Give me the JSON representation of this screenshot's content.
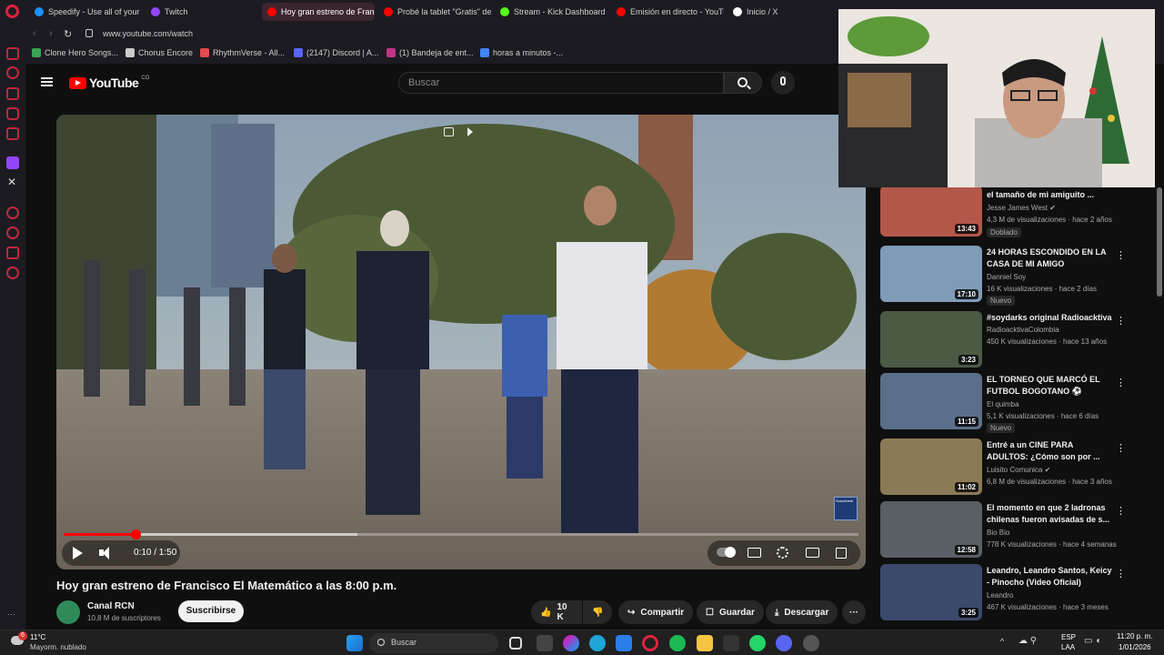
{
  "browser": {
    "tabs": [
      {
        "label": "Speedify - Use all of your",
        "color": "#1e90ff"
      },
      {
        "label": "Twitch",
        "color": "#9146ff"
      },
      {
        "label": "Hoy gran estreno de Franc",
        "color": "#ff0000",
        "active": true
      },
      {
        "label": "Probé la tablet \"Gratis\" de",
        "color": "#ff0000"
      },
      {
        "label": "Stream - Kick Dashboard",
        "color": "#53fc18"
      },
      {
        "label": "Emisión en directo - YouTu",
        "color": "#ff0000"
      },
      {
        "label": "Inicio / X",
        "color": "#ffffff"
      }
    ],
    "url": "www.youtube.com/watch",
    "bookmarks": [
      {
        "label": "Clone Hero Songs...",
        "color": "#3aa655"
      },
      {
        "label": "Chorus Encore",
        "color": "#cccccc"
      },
      {
        "label": "RhythmVerse - All...",
        "color": "#e14c4c"
      },
      {
        "label": "(2147) Discord | A...",
        "color": "#5865f2"
      },
      {
        "label": "(1) Bandeja de ent...",
        "color": "#c13584"
      },
      {
        "label": "horas a minutos -...",
        "color": "#4285f4"
      }
    ]
  },
  "youtube": {
    "logo_text": "YouTube",
    "country_code": "CO",
    "search_placeholder": "Buscar"
  },
  "player": {
    "time": "0:10 / 1:50",
    "progress": 0.09,
    "buffered": 0.37,
    "channel_watermark": "Suscríbete"
  },
  "video": {
    "title": "Hoy gran estreno de Francisco El Matemático a las 8:00 p.m.",
    "channel": "Canal RCN",
    "subscribers": "10,8 M de suscriptores",
    "subscribe_label": "Suscribirse",
    "likes": "10 K",
    "share_label": "Compartir",
    "save_label": "Guardar",
    "download_label": "Descargar",
    "more_label": "···"
  },
  "recommendations": [
    {
      "title": "el tamaño de mi amiguito ...",
      "channel": "Jesse James West",
      "verified": true,
      "meta": "4,3 M de visualizaciones · hace 2 años",
      "badge": "Doblado",
      "duration": "13:43",
      "thumb_color": "#b3574a"
    },
    {
      "title": "24 HORAS ESCONDIDO EN LA CASA DE MI AMIGO",
      "channel": "Danniel Soy",
      "verified": false,
      "meta": "16 K visualizaciones · hace 2 días",
      "badge": "Nuevo",
      "duration": "17:10",
      "thumb_color": "#7f9bb8"
    },
    {
      "title": "#soydarks original Radioacktiva",
      "channel": "RadioacktivaColombia",
      "verified": false,
      "meta": "450 K visualizaciones · hace 13 años",
      "badge": "",
      "duration": "3:23",
      "thumb_color": "#4a5a45"
    },
    {
      "title": "EL TORNEO QUE MARCÓ EL FUTBOL BOGOTANO",
      "channel": "El quimba",
      "verified": false,
      "meta": "5,1 K visualizaciones · hace 6 días",
      "badge": "Nuevo",
      "duration": "11:15",
      "thumb_color": "#5c6f8a"
    },
    {
      "title": "Entré a un CINE PARA ADULTOS: ¿Cómo son por ...",
      "channel": "Luisito Comunica",
      "verified": true,
      "meta": "6,8 M de visualizaciones · hace 3 años",
      "badge": "",
      "duration": "11:02",
      "thumb_color": "#8a7a55"
    },
    {
      "title": "El momento en que 2 ladronas chilenas fueron avisadas de s...",
      "channel": "Bio Bio",
      "verified": false,
      "meta": "778 K visualizaciones · hace 4 semanas",
      "badge": "",
      "duration": "12:58",
      "thumb_color": "#5a5f66"
    },
    {
      "title": "Leandro, Leandro Santos, Keicy - Pinocho (Video Oficial)",
      "channel": "Leandro",
      "verified": false,
      "meta": "467 K visualizaciones · hace 3 meses",
      "badge": "",
      "duration": "3:25",
      "thumb_color": "#3b4a6a"
    }
  ],
  "taskbar": {
    "weather_temp": "11°C",
    "weather_desc": "Mayorm. nublado",
    "weather_badge": "6",
    "search_label": "Buscar",
    "lang": "ESP",
    "lang_sub": "LAA",
    "time": "11:20 p. m.",
    "date": "1/01/2026"
  },
  "icons": {
    "opera": "opera-icon",
    "search": "search-icon",
    "mic": "mic-icon",
    "menu": "hamburger-icon",
    "play": "play-icon",
    "volume": "volume-icon"
  }
}
